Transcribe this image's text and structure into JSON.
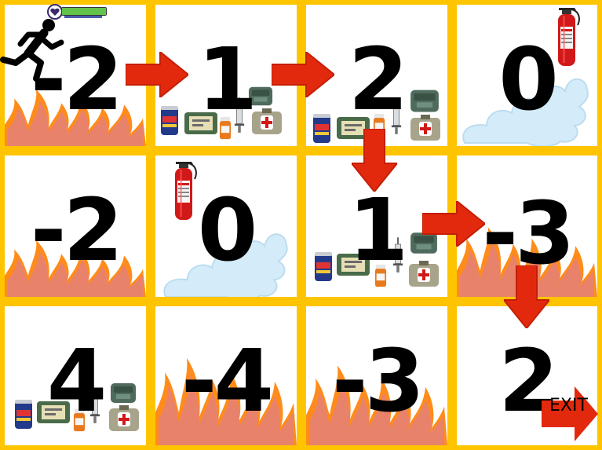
{
  "grid": {
    "rows": [
      [
        {
          "value": "-2",
          "tile": "fire",
          "player": true
        },
        {
          "value": "1",
          "tile": "supplies"
        },
        {
          "value": "2",
          "tile": "supplies"
        },
        {
          "value": "0",
          "tile": "extinguisher"
        }
      ],
      [
        {
          "value": "-2",
          "tile": "fire"
        },
        {
          "value": "0",
          "tile": "extinguisher"
        },
        {
          "value": "1",
          "tile": "supplies"
        },
        {
          "value": "-3",
          "tile": "fire"
        }
      ],
      [
        {
          "value": "4",
          "tile": "supplies"
        },
        {
          "value": "-4",
          "tile": "fire"
        },
        {
          "value": "-3",
          "tile": "fire"
        },
        {
          "value": "2",
          "tile": "exit"
        }
      ]
    ]
  },
  "path": [
    "right",
    "right",
    "down",
    "right",
    "down"
  ],
  "exit_label": "EXIT",
  "health": {
    "level": 1.0
  },
  "icons": {
    "player": "running-person-icon",
    "health": "heart-icon",
    "fire": "fire-icon",
    "smoke": "smoke-cloud-icon",
    "extinguisher": "fire-extinguisher-icon",
    "supplies": [
      "energy-drink-can-icon",
      "bandage-pack-icon",
      "pill-bottle-icon",
      "syringe-icon",
      "first-aid-kit-icon"
    ]
  },
  "colors": {
    "grid_border": "#ffc400",
    "arrow": "#e3290d",
    "fire": "#e8826b",
    "fire_edge": "#ff8c1a",
    "smoke": "#d4ecf9",
    "health_bar": "#62c24a",
    "exit_sign": "#e3290d"
  }
}
